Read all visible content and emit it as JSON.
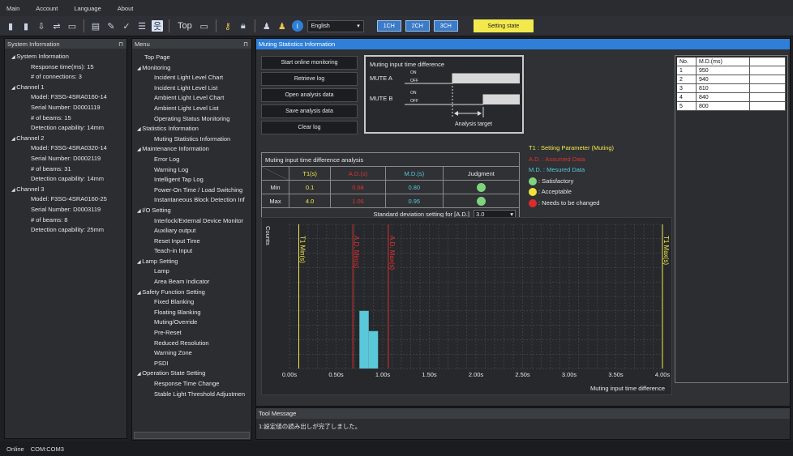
{
  "menubar": {
    "items": [
      "Main",
      "Account",
      "Language",
      "About"
    ]
  },
  "toolbar": {
    "top_label": "Top",
    "language": "English",
    "ch_buttons": [
      "1CH",
      "2CH",
      "3CH"
    ],
    "setting_state": "Setting state"
  },
  "system_info": {
    "title": "System Information",
    "items": [
      {
        "t": "System Information",
        "lvl": 0,
        "arrow": true
      },
      {
        "t": "Response time(ms): 15",
        "lvl": 1
      },
      {
        "t": "# of connections: 3",
        "lvl": 1
      },
      {
        "t": "Channel 1",
        "lvl": 0,
        "arrow": true
      },
      {
        "t": "Model: F3SG-4SRA0160-14",
        "lvl": 1
      },
      {
        "t": "Serial Number: D0001119",
        "lvl": 1
      },
      {
        "t": "# of beams: 15",
        "lvl": 1
      },
      {
        "t": "Detection capability: 14mm",
        "lvl": 1
      },
      {
        "t": "Channel 2",
        "lvl": 0,
        "arrow": true
      },
      {
        "t": "Model: F3SG-4SRA0320-14",
        "lvl": 1
      },
      {
        "t": "Serial Number: D0002119",
        "lvl": 1
      },
      {
        "t": "# of beams: 31",
        "lvl": 1
      },
      {
        "t": "Detection capability: 14mm",
        "lvl": 1
      },
      {
        "t": "Channel 3",
        "lvl": 0,
        "arrow": true
      },
      {
        "t": "Model: F3SG-4SRA0160-25",
        "lvl": 1
      },
      {
        "t": "Serial Number: D0003119",
        "lvl": 1
      },
      {
        "t": "# of beams: 8",
        "lvl": 1
      },
      {
        "t": "Detection capability: 25mm",
        "lvl": 1
      }
    ]
  },
  "menu": {
    "title": "Menu",
    "items": [
      {
        "t": "Top Page",
        "lvl": 1
      },
      {
        "t": "Monitoring",
        "lvl": 0,
        "arrow": true
      },
      {
        "t": "Incident Light Level Chart",
        "lvl": 2
      },
      {
        "t": "Incident Light Level List",
        "lvl": 2
      },
      {
        "t": "Ambient Light Level Chart",
        "lvl": 2
      },
      {
        "t": "Ambient Light Level List",
        "lvl": 2
      },
      {
        "t": "Operating Status Monitoring",
        "lvl": 2
      },
      {
        "t": "Statistics Information",
        "lvl": 0,
        "arrow": true
      },
      {
        "t": "Muting Statistics Information",
        "lvl": 2
      },
      {
        "t": "Maintenance Information",
        "lvl": 0,
        "arrow": true
      },
      {
        "t": "Error Log",
        "lvl": 2
      },
      {
        "t": "Warning Log",
        "lvl": 2
      },
      {
        "t": "Intelligent Tap Log",
        "lvl": 2
      },
      {
        "t": "Power-On Time / Load Switching",
        "lvl": 2
      },
      {
        "t": "Instantaneous Block Detection Inf",
        "lvl": 2
      },
      {
        "t": "I/O Setting",
        "lvl": 0,
        "arrow": true
      },
      {
        "t": "Interlock/External Device Monitor",
        "lvl": 2
      },
      {
        "t": "Auxiliary output",
        "lvl": 2
      },
      {
        "t": "Reset Input Time",
        "lvl": 2
      },
      {
        "t": "Teach-in Input",
        "lvl": 2
      },
      {
        "t": "Lamp Setting",
        "lvl": 0,
        "arrow": true
      },
      {
        "t": "Lamp",
        "lvl": 2
      },
      {
        "t": "Area Beam Indicator",
        "lvl": 2
      },
      {
        "t": "Safety Function Setting",
        "lvl": 0,
        "arrow": true
      },
      {
        "t": "Fixed Blanking",
        "lvl": 2
      },
      {
        "t": "Floating Blanking",
        "lvl": 2
      },
      {
        "t": "Muting/Override",
        "lvl": 2
      },
      {
        "t": "Pre-Reset",
        "lvl": 2
      },
      {
        "t": "Reduced Resolution",
        "lvl": 2
      },
      {
        "t": "Warning Zone",
        "lvl": 2
      },
      {
        "t": "PSDI",
        "lvl": 2
      },
      {
        "t": "Operation State Setting",
        "lvl": 0,
        "arrow": true
      },
      {
        "t": "Response Time Change",
        "lvl": 2
      },
      {
        "t": "Stable Light Threshold Adjustmen",
        "lvl": 2
      }
    ]
  },
  "main": {
    "title": "Muting Statistics Information",
    "buttons": [
      "Start online monitoring",
      "Retrieve log",
      "Open analysis data",
      "Save analysis data",
      "Clear log"
    ],
    "diagram": {
      "title": "Muting input time difference",
      "mute_a": "MUTE A",
      "mute_b": "MUTE B",
      "on": "ON",
      "off": "OFF",
      "target": "Analysis target"
    },
    "analysis": {
      "title": "Muting input time difference analysis",
      "headers": [
        "T1(s)",
        "A.D.(s)",
        "M.D.(s)",
        "Judgment"
      ],
      "rows": [
        {
          "label": "Min",
          "t1": "0.1",
          "ad": "0.68",
          "md": "0.80",
          "judgment": "green"
        },
        {
          "label": "Max",
          "t1": "4.0",
          "ad": "1.06",
          "md": "0.95",
          "judgment": "green"
        }
      ],
      "std_label": "Standard deviation setting for [A.D.]",
      "std_value": "3.0"
    },
    "legend": {
      "t1": "T1 : Setting Parameter (Muting)",
      "ad": "A.D. : Assumed Data",
      "md": "M.D. : Mesured Data",
      "sat": ": Satisfactory",
      "acc": ": Acceptable",
      "chg": ": Needs to be changed"
    },
    "md_table": {
      "headers": [
        "No.",
        "M.D.(ms)"
      ],
      "rows": [
        [
          "1",
          "950"
        ],
        [
          "2",
          "940"
        ],
        [
          "3",
          "810"
        ],
        [
          "4",
          "840"
        ],
        [
          "5",
          "800"
        ]
      ]
    }
  },
  "colors": {
    "t1": "#f3e94d",
    "ad": "#e03030",
    "md": "#5ac8d8",
    "green": "#7fd37f",
    "yellow": "#f1e23a",
    "red": "#e02a2a"
  },
  "chart_data": {
    "type": "bar",
    "xlabel": "Muting input time difference",
    "ylabel": "Counts",
    "xlim": [
      0,
      4.0
    ],
    "x_ticks": [
      "0.00s",
      "0.50s",
      "1.00s",
      "1.50s",
      "2.00s",
      "2.50s",
      "3.00s",
      "3.50s",
      "4.00s"
    ],
    "bins": [
      {
        "x0": 0.75,
        "x1": 0.85,
        "count": 2
      },
      {
        "x0": 0.85,
        "x1": 0.95,
        "count": 1.3
      }
    ],
    "ymax": 5,
    "lines": [
      {
        "x": 0.1,
        "label": "T1 Min(s)",
        "color": "#f3e94d"
      },
      {
        "x": 4.0,
        "label": "T1 Max(s)",
        "color": "#f3e94d"
      },
      {
        "x": 0.68,
        "label": "A.D. Min(s)",
        "color": "#e03030"
      },
      {
        "x": 1.06,
        "label": "A.D. Max(s)",
        "color": "#e03030"
      }
    ]
  },
  "tool_message": {
    "title": "Tool Message",
    "text": "1:設定値の読み出しが完了しました。"
  },
  "status": {
    "state": "Online",
    "port": "COM:COM3"
  }
}
